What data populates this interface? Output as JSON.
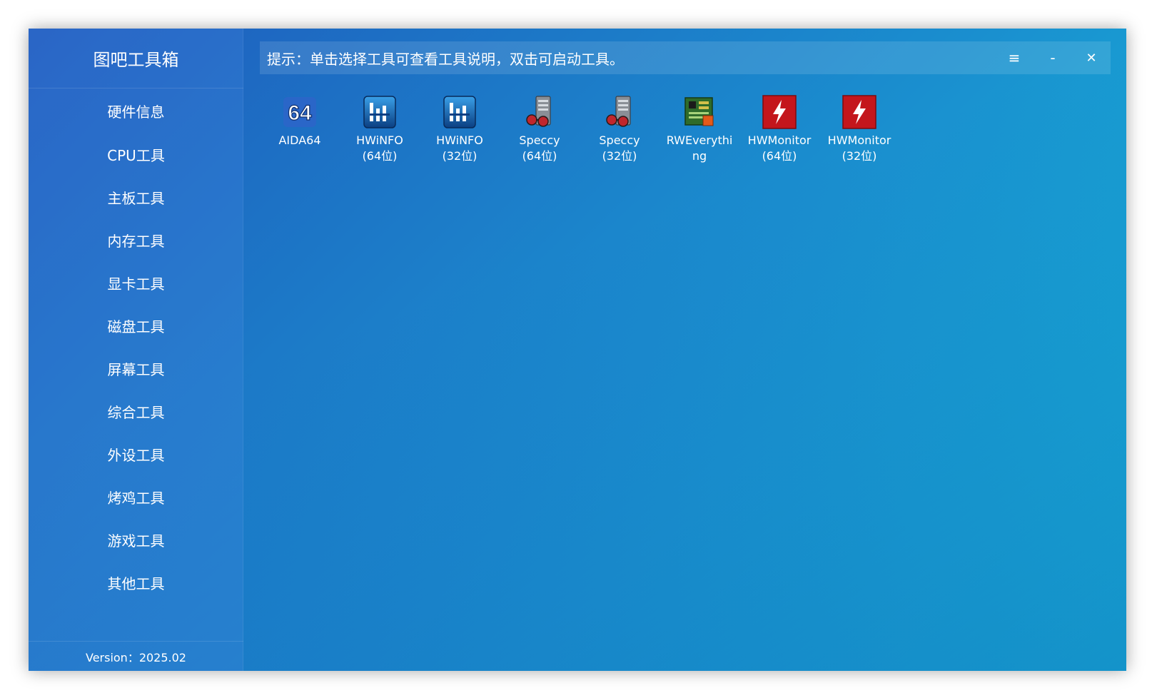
{
  "app": {
    "title": "图吧工具箱",
    "version": "Version：2025.02"
  },
  "topbar": {
    "hint": "提示：单击选择工具可查看工具说明，双击可启动工具。",
    "menu_glyph": "≡",
    "minimize_glyph": "-",
    "close_glyph": "✕"
  },
  "sidebar": {
    "items": [
      {
        "label": "硬件信息"
      },
      {
        "label": "CPU工具"
      },
      {
        "label": "主板工具"
      },
      {
        "label": "内存工具"
      },
      {
        "label": "显卡工具"
      },
      {
        "label": "磁盘工具"
      },
      {
        "label": "屏幕工具"
      },
      {
        "label": "综合工具"
      },
      {
        "label": "外设工具"
      },
      {
        "label": "烤鸡工具"
      },
      {
        "label": "游戏工具"
      },
      {
        "label": "其他工具"
      }
    ]
  },
  "tools": [
    {
      "line1": "AIDA64",
      "line2": "",
      "icon": "aida64-icon"
    },
    {
      "line1": "HWiNFO",
      "line2": "(64位)",
      "icon": "hwinfo-icon"
    },
    {
      "line1": "HWiNFO",
      "line2": "(32位)",
      "icon": "hwinfo-icon"
    },
    {
      "line1": "Speccy",
      "line2": "(64位)",
      "icon": "speccy-icon"
    },
    {
      "line1": "Speccy",
      "line2": "(32位)",
      "icon": "speccy-icon"
    },
    {
      "line1": "RWEverythi",
      "line2": "ng",
      "icon": "rweverything-icon"
    },
    {
      "line1": "HWMonitor",
      "line2": "(64位)",
      "icon": "hwmonitor-icon"
    },
    {
      "line1": "HWMonitor",
      "line2": "(32位)",
      "icon": "hwmonitor-icon"
    }
  ],
  "icon_glyphs": {
    "aida64": "64"
  }
}
